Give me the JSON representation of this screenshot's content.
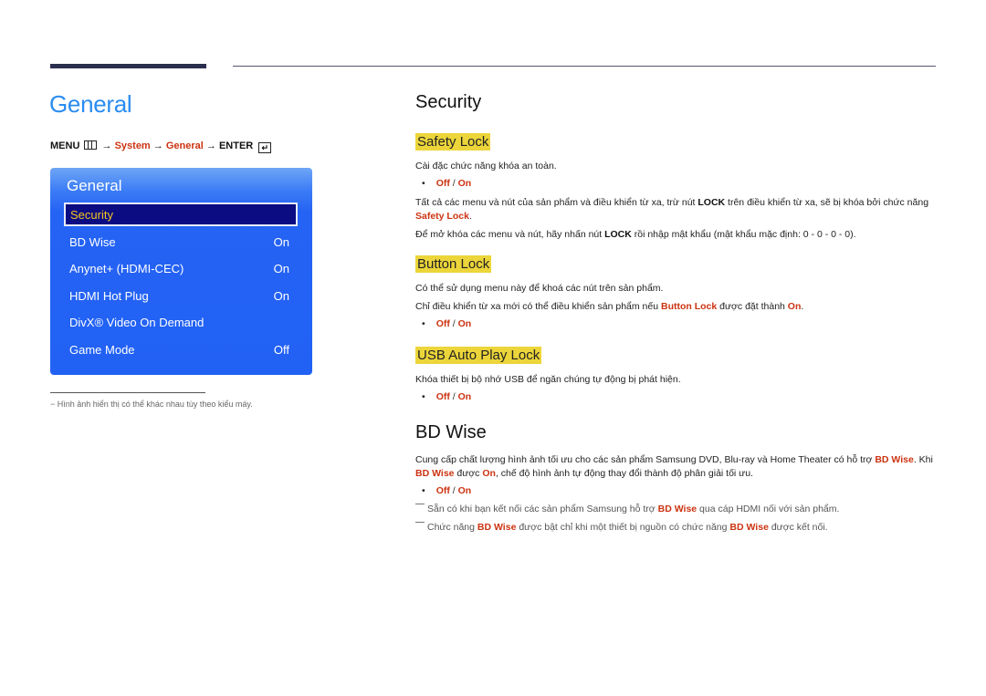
{
  "page": {
    "title": "General",
    "menu_path": {
      "menu": "MENU",
      "menu_icon": "menu-grid-icon",
      "arrow": "→",
      "system": "System",
      "general": "General",
      "enter": "ENTER",
      "enter_icon": "enter-icon"
    }
  },
  "panel": {
    "title": "General",
    "items": [
      {
        "label": "Security",
        "value": "",
        "selected": true
      },
      {
        "label": "BD Wise",
        "value": "On"
      },
      {
        "label": "Anynet+ (HDMI-CEC)",
        "value": "On"
      },
      {
        "label": "HDMI Hot Plug",
        "value": "On"
      },
      {
        "label": "DivX® Video On Demand",
        "value": ""
      },
      {
        "label": "Game Mode",
        "value": "Off"
      }
    ]
  },
  "footnote": "−  Hình ảnh hiển thị có thể khác nhau tùy theo kiểu máy.",
  "security": {
    "title": "Security",
    "safety_lock": {
      "title": "Safety Lock",
      "desc": "Cài đặc chức năng khóa an toàn.",
      "off": "Off",
      "slash": " / ",
      "on": "On",
      "p1_a": "Tất cả các menu và nút của sản phẩm và điều khiển từ xa, trừ nút ",
      "p1_lock": "LOCK",
      "p1_b": " trên điều khiển từ xa, sẽ bị khóa bởi chức năng ",
      "p1_hl": "Safety Lock",
      "p1_c": ".",
      "p2_a": "Để mở khóa các menu và nút, hãy nhấn nút ",
      "p2_lock": "LOCK",
      "p2_b": " rồi nhập mật khẩu (mật khẩu mặc định: 0 - 0 - 0 - 0)."
    },
    "button_lock": {
      "title": "Button Lock",
      "desc": "Có thể sử dụng menu này để khoá các nút trên sản phẩm.",
      "p_a": "Chỉ điều khiển từ xa mới có thể điều khiển sản phẩm nếu ",
      "p_hl": "Button Lock",
      "p_b": " được đặt thành ",
      "p_on": "On",
      "p_c": ".",
      "off": "Off",
      "slash": " / ",
      "on": "On"
    },
    "usb_lock": {
      "title": "USB Auto Play Lock",
      "desc": "Khóa thiết bị bộ nhớ USB để ngăn chúng tự động bị phát hiện.",
      "off": "Off",
      "slash": " / ",
      "on": "On"
    }
  },
  "bd_wise": {
    "title": "BD Wise",
    "p_a": "Cung cấp chất lượng hình ảnh tối ưu cho các sản phẩm Samsung DVD, Blu-ray và Home Theater có hỗ trợ ",
    "p_hl1": "BD Wise",
    "p_b": ". Khi ",
    "p_hl2": "BD Wise",
    "p_c": " được ",
    "p_on": "On",
    "p_d": ", chế độ hình ảnh tự động thay đổi thành độ phân giải tối ưu.",
    "off": "Off",
    "slash": " / ",
    "on": "On",
    "note1_a": "Sẵn có khi bạn kết nối các sản phẩm Samsung hỗ trợ ",
    "note1_hl": "BD Wise",
    "note1_b": " qua cáp HDMI nối với sản phẩm.",
    "note2_a": "Chức năng ",
    "note2_hl1": "BD Wise",
    "note2_b": " được bật chỉ khi một thiết bị nguồn có chức năng ",
    "note2_hl2": "BD Wise",
    "note2_c": " được kết nối."
  }
}
